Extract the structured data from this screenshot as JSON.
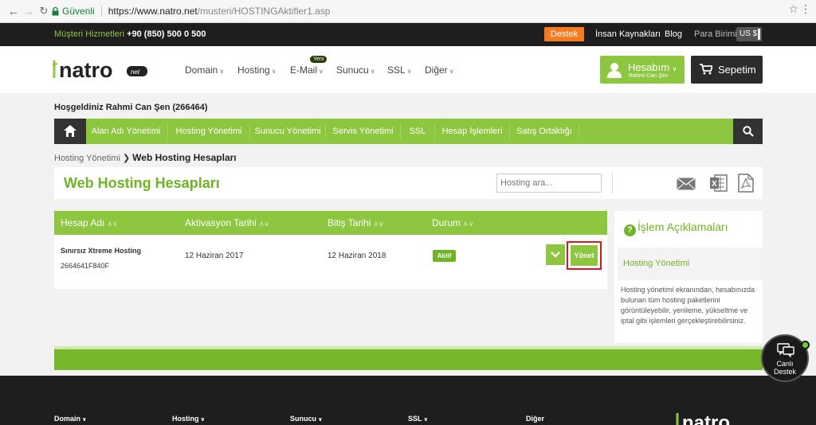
{
  "browser": {
    "secure_label": "Güvenli",
    "url_host": "https://www.natro.net",
    "url_path": "/musteri/HOSTINGAktifler1.asp"
  },
  "topbar": {
    "customer_service_label": "Müşteri Hizmetleri",
    "phone": "+90 (850) 500 0 500",
    "support_button": "Destek",
    "hr_link": "İnsan Kaynakları",
    "blog_link": "Blog",
    "currency_label": "Para Birimi",
    "currency_value": "US $"
  },
  "header": {
    "logo_text": "natro",
    "logo_badge": "net",
    "nav": [
      {
        "label": "Domain"
      },
      {
        "label": "Hosting"
      },
      {
        "label": "E-Mail"
      },
      {
        "label": "Sunucu"
      },
      {
        "label": "SSL"
      },
      {
        "label": "Diğer"
      }
    ],
    "new_badge": "Yeni",
    "account_label": "Hesabım",
    "account_user": "Rahmi Can Şen",
    "cart_label": "Sepetim"
  },
  "welcome": "Hoşgeldiniz Rahmi Can Şen (266464)",
  "green_nav": [
    {
      "label": "Alan Adı Yönetimi"
    },
    {
      "label": "Hosting Yönetimi"
    },
    {
      "label": "Sunucu Yönetimi"
    },
    {
      "label": "Servis Yönetimi"
    },
    {
      "label": "SSL"
    },
    {
      "label": "Hesap İşlemleri"
    },
    {
      "label": "Satış Ortaklığı"
    }
  ],
  "breadcrumb": {
    "parent": "Hosting Yönetimi",
    "current": "Web Hosting Hesapları"
  },
  "page_title": "Web Hosting Hesapları",
  "search_placeholder": "Hosting ara...",
  "table": {
    "headers": [
      "Hesap Adı",
      "Aktivasyon Tarihi",
      "Bitiş Tarihi",
      "Durum"
    ],
    "rows": [
      {
        "package": "Sınırsız Xtreme Hosting",
        "account_id": "2664641F840F",
        "activation": "12 Haziran 2017",
        "expiry": "12 Haziran 2018",
        "status": "Aktif",
        "action": "Yönet"
      }
    ]
  },
  "side_panel": {
    "heading": "İşlem Açıklamaları",
    "subheading": "Hosting Yönetimi",
    "description": "Hosting yönetimi ekranından, hesabınızda bulunan tüm hosting paketlerini görüntüleyebilir, yenileme, yükseltme ve iptal gibi işlemleri gerçekleştirebilirsiniz."
  },
  "footer": {
    "columns": [
      "Domain",
      "Hosting",
      "Sunucu",
      "SSL",
      "Diğer"
    ]
  },
  "live_support": {
    "line1": "Canlı",
    "line2": "Destek"
  },
  "colors": {
    "brand_green": "#8dc63f",
    "dark_green": "#6fb425",
    "support_orange": "#f47b20",
    "highlight_red": "#e3141b",
    "dark": "#1e1e1e"
  }
}
